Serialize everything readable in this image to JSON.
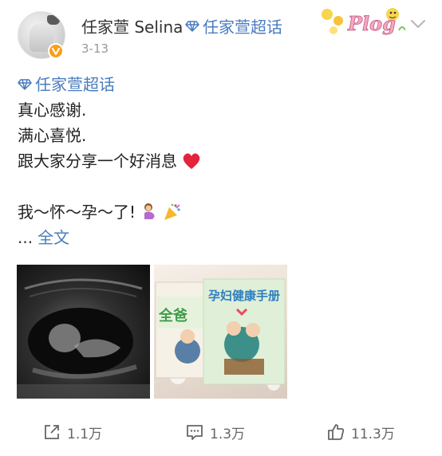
{
  "post": {
    "author": "任家萱 Selina",
    "topic_tag": "任家萱超话",
    "time": "3-13",
    "deco_text": "Plog",
    "content": {
      "topic": "任家萱超话",
      "line1": "真心感谢.",
      "line2": "满心喜悦.",
      "line3": "跟大家分享一个好消息",
      "line4": "我～怀～孕～了!",
      "ellipsis": "...",
      "expand": "全文"
    },
    "images": {
      "book1_title": "全爸",
      "book2_title": "孕妇健康手册"
    },
    "actions": {
      "repost": "1.1万",
      "comment": "1.3万",
      "like": "11.3万"
    }
  },
  "colors": {
    "link": "#4a7cbf",
    "text": "#333333",
    "muted": "#999999",
    "badge": "#f6a019"
  },
  "icons": [
    "verified-badge-icon",
    "diamond-icon",
    "chevron-down-icon",
    "heart-icon",
    "pregnant-woman-icon",
    "party-popper-icon",
    "repost-icon",
    "comment-icon",
    "like-icon"
  ]
}
